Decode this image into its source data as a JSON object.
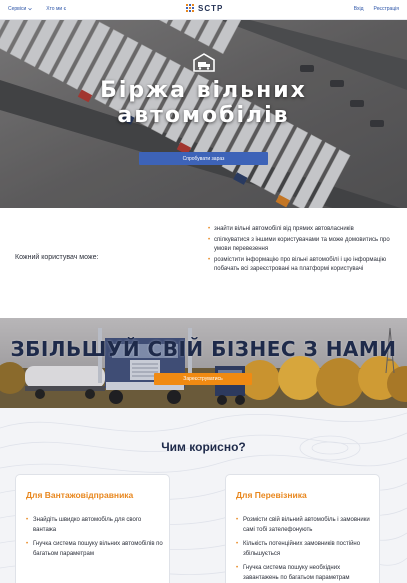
{
  "topbar": {
    "language": "Сервіси",
    "about": "Хто ми є",
    "logo_text": "SCTP",
    "login": "Вхід",
    "register": "Реєстрація"
  },
  "hero": {
    "title_line1": "Біржа вільних",
    "title_line2": "автомобілів",
    "cta": "Спробувати зараз"
  },
  "info": {
    "lead": "Кожний користувач може:",
    "items": [
      "знайти вільні автомобілі від прямих автовласників",
      "спілкуватися з іншими користувачами та може домовитись про умови перевезення",
      "розмістити інформацію про вільні автомобілі і цю інформацію побачать всі зареєстровані на платформі користувачі"
    ]
  },
  "banner": {
    "title": "ЗБІЛЬШУЙ СВІЙ БІЗНЕС З НАМИ",
    "button": "Зареєструватись"
  },
  "benefits": {
    "title": "Чим корисно?",
    "cards": [
      {
        "title": "Для Вантажовідправника",
        "items": [
          "Знайдіть швидко автомобіль для свого вантажа",
          "Гнучка система пошуку вільних автомобілів по багатьом параметрам"
        ]
      },
      {
        "title": "Для Перевізника",
        "items": [
          "Розмісти свій вільний автомобіль і замовники самі тобі зателефонують",
          "Кількість потенційних замовників постійно збільшується",
          "Гнучка система пошуку необхідних завантажень по багатьом параметрам"
        ]
      }
    ]
  },
  "colors": {
    "primary_blue": "#3d63b8",
    "accent_orange": "#e8871e",
    "heading_navy": "#1e2a4a"
  }
}
